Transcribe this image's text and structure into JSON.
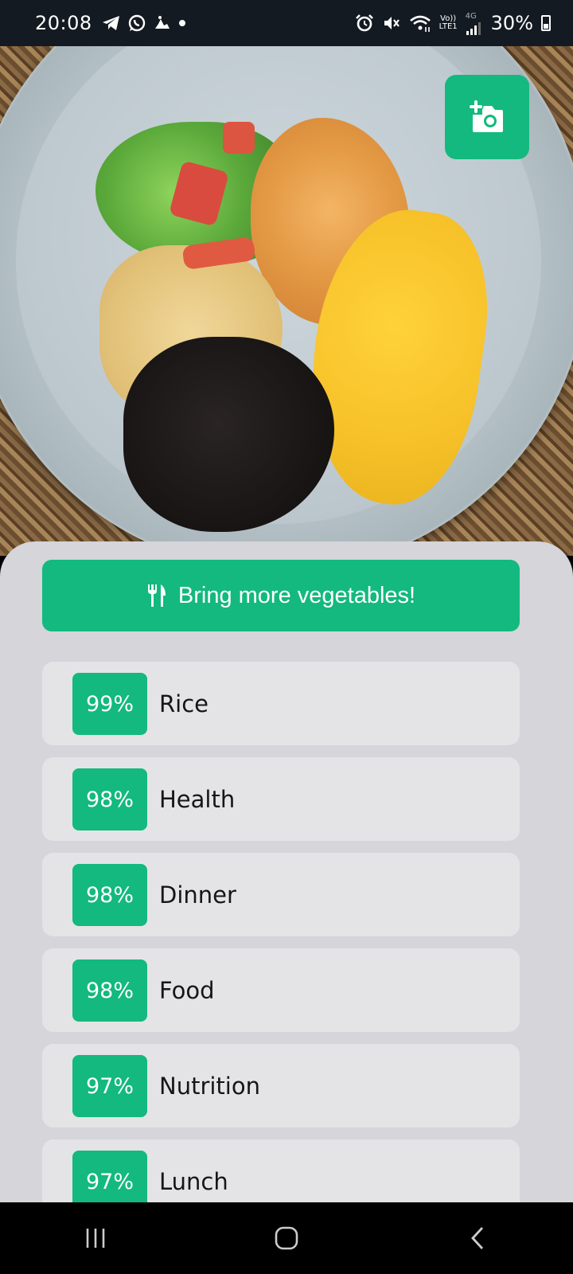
{
  "status_bar": {
    "time": "20:08",
    "left_icons": [
      "telegram-icon",
      "whatsapp-icon",
      "cloud-notification-icon",
      "dot-icon"
    ],
    "right_icons": [
      "alarm-icon",
      "mute-icon",
      "wifi-icon",
      "volte-icon",
      "signal-icon",
      "battery-icon"
    ],
    "volte_label_top": "Vo))",
    "volte_label_bottom": "LTE1",
    "network": "4G",
    "battery": "30%"
  },
  "camera_button": {
    "icon": "add-photo-icon"
  },
  "banner": {
    "icon": "fork-knife-icon",
    "text": "Bring more vegetables!"
  },
  "results": [
    {
      "confidence": "99%",
      "label": "Rice"
    },
    {
      "confidence": "98%",
      "label": "Health"
    },
    {
      "confidence": "98%",
      "label": "Dinner"
    },
    {
      "confidence": "98%",
      "label": "Food"
    },
    {
      "confidence": "97%",
      "label": "Nutrition"
    },
    {
      "confidence": "97%",
      "label": "Lunch"
    }
  ],
  "nav_bar": {
    "buttons": [
      "recents-icon",
      "home-icon",
      "back-icon"
    ]
  },
  "colors": {
    "accent": "#13b97e",
    "sheet_bg": "#d5d5da",
    "item_bg": "#e4e4e7",
    "status_bg": "#141a22"
  }
}
